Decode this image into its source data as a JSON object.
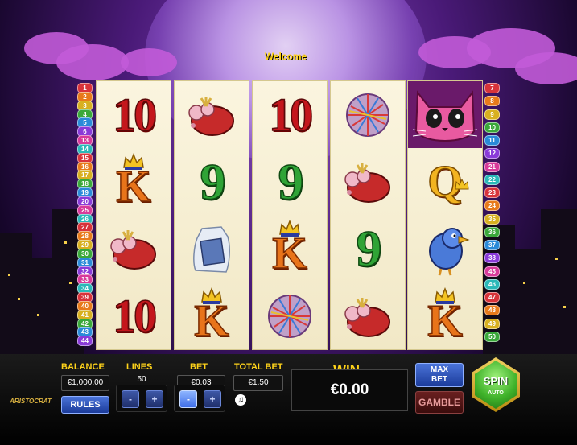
{
  "welcome": "Welcome",
  "lines_left": [
    "1",
    "2",
    "3",
    "4",
    "5",
    "6",
    "13",
    "14",
    "15",
    "16",
    "17",
    "18",
    "19",
    "20",
    "25",
    "26",
    "27",
    "28",
    "29",
    "30",
    "31",
    "32",
    "33",
    "34",
    "39",
    "40",
    "41",
    "42",
    "43",
    "44"
  ],
  "lines_right": [
    "7",
    "8",
    "9",
    "10",
    "11",
    "12",
    "21",
    "22",
    "23",
    "24",
    "35",
    "36",
    "37",
    "38",
    "45",
    "46",
    "47",
    "48",
    "49",
    "50"
  ],
  "reels": [
    [
      "10",
      "K",
      "mouse",
      "10"
    ],
    [
      "mouse",
      "9",
      "milk",
      "K"
    ],
    [
      "10",
      "9",
      "K",
      "yarn"
    ],
    [
      "yarn",
      "mouse",
      "9",
      "mouse"
    ],
    [
      "cat",
      "Q",
      "bird",
      "K"
    ]
  ],
  "panel": {
    "balance_label": "BALANCE",
    "balance_value": "€1,000.00",
    "rules": "RULES",
    "lines_label": "LINES",
    "lines_value": "50",
    "bet_label": "BET",
    "bet_value": "€0.03",
    "total_bet_label": "TOTAL BET",
    "total_bet_value": "€1.50",
    "win_label": "WIN",
    "win_value": "€0.00",
    "max_bet_1": "MAX",
    "max_bet_2": "BET",
    "gamble": "GAMBLE",
    "spin": "SPIN",
    "auto": "AUTO",
    "minus": "-",
    "plus": "+",
    "logo": "ARISTOCRAT"
  },
  "icons": {
    "sound": "music-note-icon"
  },
  "colors": {
    "gold_label": "#ffd31a",
    "red_ten": "#c4161c",
    "green_nine": "#2fa336",
    "spin_green": "#3fb22a"
  }
}
